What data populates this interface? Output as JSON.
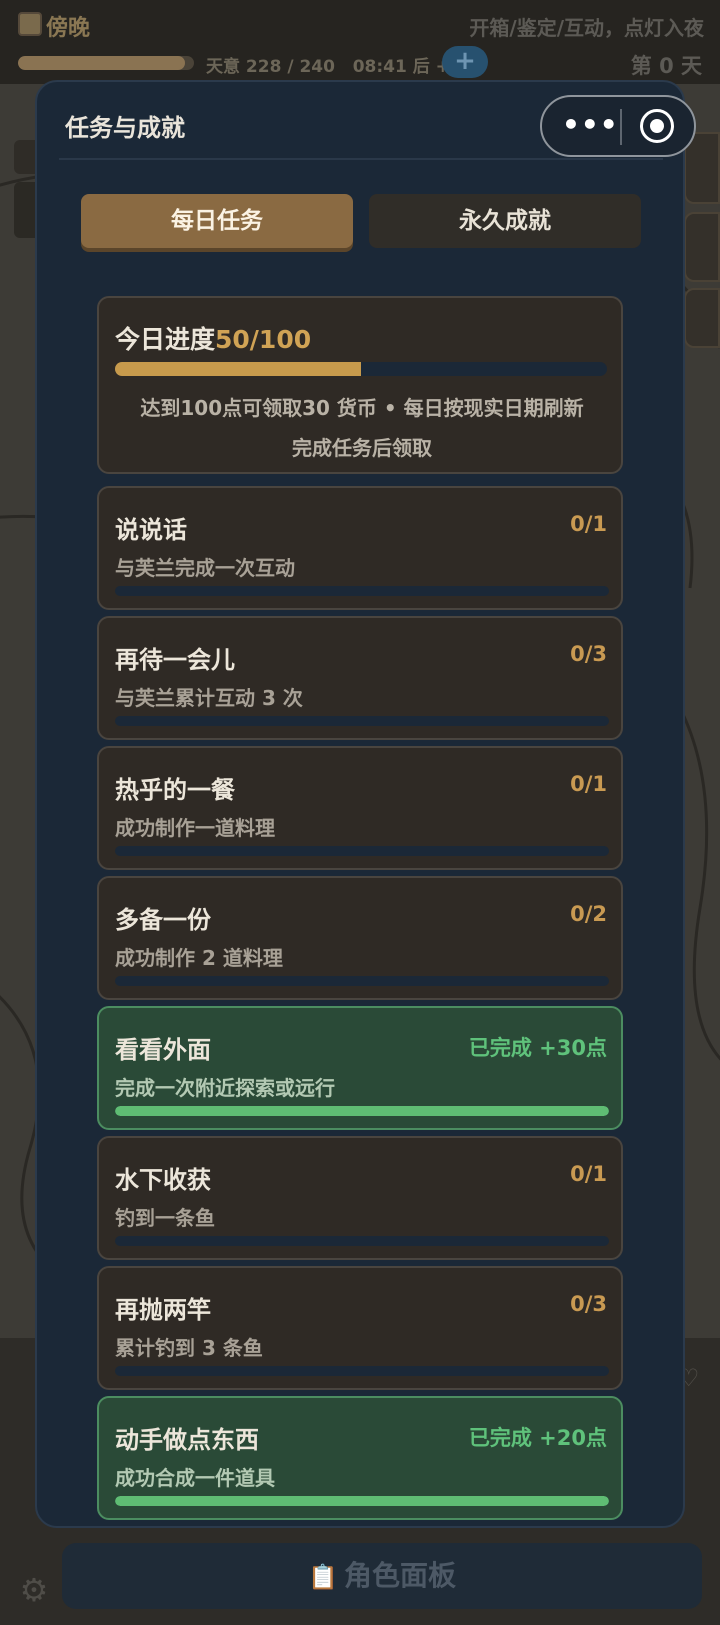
{
  "topbar": {
    "time_label": "傍晚",
    "hint": "开箱/鉴定/互动，点灯入夜",
    "stamina_text": "天意 228 / 240",
    "stamina_fraction": 0.95,
    "timer_text": "08:41 后 +1",
    "plus_label": "+",
    "day_label": "第 0 天"
  },
  "modal": {
    "title": "任务与成就",
    "tabs": [
      {
        "label": "每日任务",
        "active": true
      },
      {
        "label": "永久成就",
        "active": false
      }
    ],
    "progress": {
      "title": "今日进度",
      "value": "50/100",
      "fraction": 0.5,
      "desc_line1": "达到100点可领取30 货币 • 每日按现实日期刷新",
      "desc_line2": "完成任务后领取"
    },
    "tasks": [
      {
        "name": "说说话",
        "desc": "与芙兰完成一次互动",
        "status": "0/1",
        "completed": false,
        "progress": 0
      },
      {
        "name": "再待一会儿",
        "desc": "与芙兰累计互动 3 次",
        "status": "0/3",
        "completed": false,
        "progress": 0
      },
      {
        "name": "热乎的一餐",
        "desc": "成功制作一道料理",
        "status": "0/1",
        "completed": false,
        "progress": 0
      },
      {
        "name": "多备一份",
        "desc": "成功制作 2 道料理",
        "status": "0/2",
        "completed": false,
        "progress": 0
      },
      {
        "name": "看看外面",
        "desc": "完成一次附近探索或远行",
        "status": "已完成  +30点",
        "completed": true,
        "progress": 1
      },
      {
        "name": "水下收获",
        "desc": "钓到一条鱼",
        "status": "0/1",
        "completed": false,
        "progress": 0
      },
      {
        "name": "再抛两竿",
        "desc": "累计钓到 3 条鱼",
        "status": "0/3",
        "completed": false,
        "progress": 0
      },
      {
        "name": "动手做点东西",
        "desc": "成功合成一件道具",
        "status": "已完成  +20点",
        "completed": true,
        "progress": 1
      }
    ]
  },
  "bottom": {
    "role_button_label": "角色面板"
  },
  "icons": {
    "time": "sunset-icon",
    "more": "more-dots-icon",
    "close": "target-close-icon",
    "settings": "gear-icon",
    "clipboard": "clipboard-icon",
    "heart": "heart-icon"
  },
  "colors": {
    "accent_gold": "#c79a4c",
    "modal_bg": "#1b2837",
    "card_bg": "#2f2a25",
    "done_bg": "#2a4a37",
    "done_text": "#5fc27b"
  }
}
